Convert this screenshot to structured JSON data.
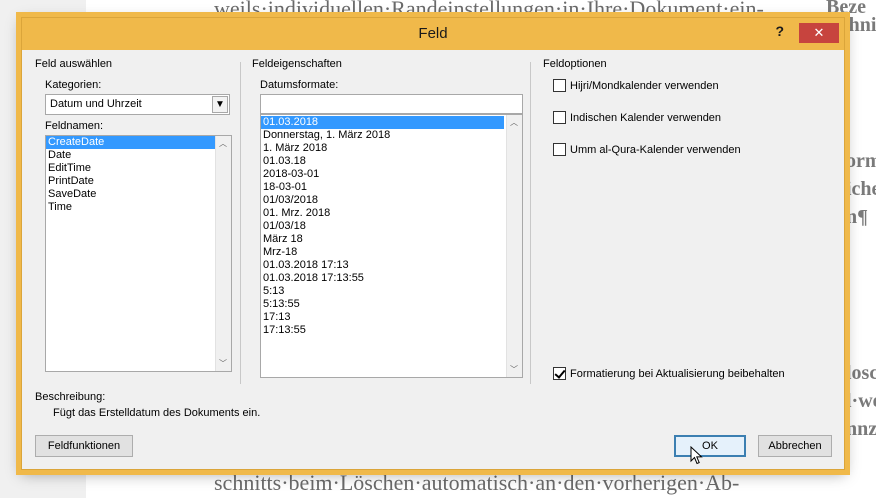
{
  "background_document": {
    "top_line": "weils·individuellen·Randeinstellungen·in·Ihre·Dokument·ein-",
    "bottom_line": "schnitts·beim·Löschen·automatisch·an·den·vorherigen·Ab-",
    "right_fragments": [
      "Beze",
      "schni",
      "orm",
      "iche",
      "n¶",
      "losch",
      "l·we",
      "nnz"
    ]
  },
  "dialog": {
    "title": "Feld",
    "help": "?",
    "close": "✕"
  },
  "left": {
    "section": "Feld auswählen",
    "categories_label": "Kategorien:",
    "category_value": "Datum und Uhrzeit",
    "fieldnames_label": "Feldnamen:",
    "fieldnames": [
      "CreateDate",
      "Date",
      "EditTime",
      "PrintDate",
      "SaveDate",
      "Time"
    ]
  },
  "middle": {
    "section": "Feldeigenschaften",
    "formats_label": "Datumsformate:",
    "format_input": "",
    "formats": [
      "01.03.2018",
      "Donnerstag, 1. März 2018",
      "1. März 2018",
      "01.03.18",
      "2018-03-01",
      "18-03-01",
      "01/03/2018",
      "01. Mrz. 2018",
      "01/03/18",
      "März 18",
      "Mrz-18",
      "01.03.2018 17:13",
      "01.03.2018 17:13:55",
      "5:13",
      "5:13:55",
      "17:13",
      "17:13:55"
    ]
  },
  "right": {
    "section": "Feldoptionen",
    "hijri": "Hijri/Mondkalender verwenden",
    "indian": "Indischen Kalender verwenden",
    "umm": "Umm al-Qura-Kalender verwenden",
    "preserve": "Formatierung bei Aktualisierung beibehalten"
  },
  "description": {
    "label": "Beschreibung:",
    "text": "Fügt das Erstelldatum des Dokuments ein."
  },
  "buttons": {
    "field_codes": "Feldfunktionen",
    "ok": "OK",
    "cancel": "Abbrechen"
  }
}
